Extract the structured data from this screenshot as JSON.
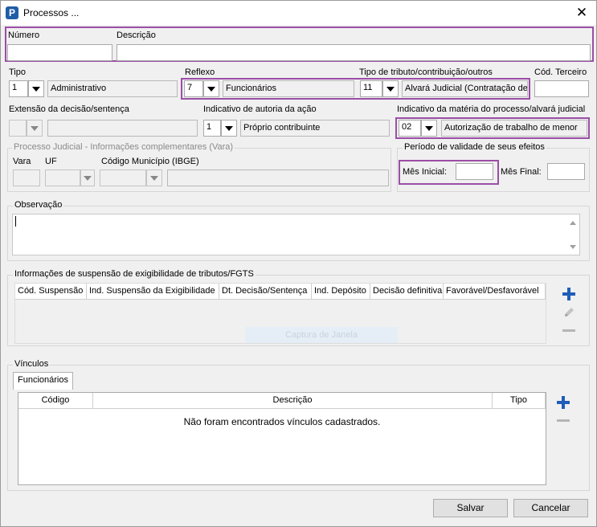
{
  "window": {
    "title": "Processos ...",
    "icon_letter": "P"
  },
  "fields": {
    "numero_label": "Número",
    "descricao_label": "Descrição",
    "tipo_label": "Tipo",
    "tipo_code": "1",
    "tipo_value": "Administrativo",
    "reflexo_label": "Reflexo",
    "reflexo_code": "7",
    "reflexo_value": "Funcionários",
    "tributo_label": "Tipo de tributo/contribuição/outros",
    "tributo_code": "11",
    "tributo_value": "Alvará Judicial (Contratação de",
    "cod_terceiro_label": "Cód. Terceiro",
    "extensao_label": "Extensão da decisão/sentença",
    "autoria_label": "Indicativo de autoria da ação",
    "autoria_code": "1",
    "autoria_value": "Próprio contribuinte",
    "materia_label": "Indicativo da matéria do processo/alvará judicial",
    "materia_code": "02",
    "materia_value": "Autorização de trabalho de menor"
  },
  "judicial": {
    "title": "Processo Judicial - Informações complementares (Vara)",
    "vara_label": "Vara",
    "uf_label": "UF",
    "municipio_label": "Código Município (IBGE)"
  },
  "periodo": {
    "title": "Período de validade de seus efeitos",
    "mes_inicial_label": "Mês Inicial:",
    "mes_final_label": "Mês Final:"
  },
  "observacao": {
    "title": "Observação"
  },
  "suspensao": {
    "title": "Informações de suspensão de exigibilidade de tributos/FGTS",
    "columns": [
      "Cód. Suspensão",
      "Ind. Suspensão da Exigibilidade",
      "Dt. Decisão/Sentença",
      "Ind. Depósito",
      "Decisão definitiva",
      "Favorável/Desfavorável"
    ],
    "watermark": "Captura de Janela"
  },
  "vinculos": {
    "title": "Vínculos",
    "tab": "Funcionários",
    "columns": [
      "Código",
      "Descrição",
      "Tipo"
    ],
    "empty_message": "Não foram encontrados vínculos cadastrados."
  },
  "buttons": {
    "save": "Salvar",
    "cancel": "Cancelar"
  },
  "colors": {
    "highlight": "#9b4ea6",
    "accent": "#1f5db8"
  }
}
